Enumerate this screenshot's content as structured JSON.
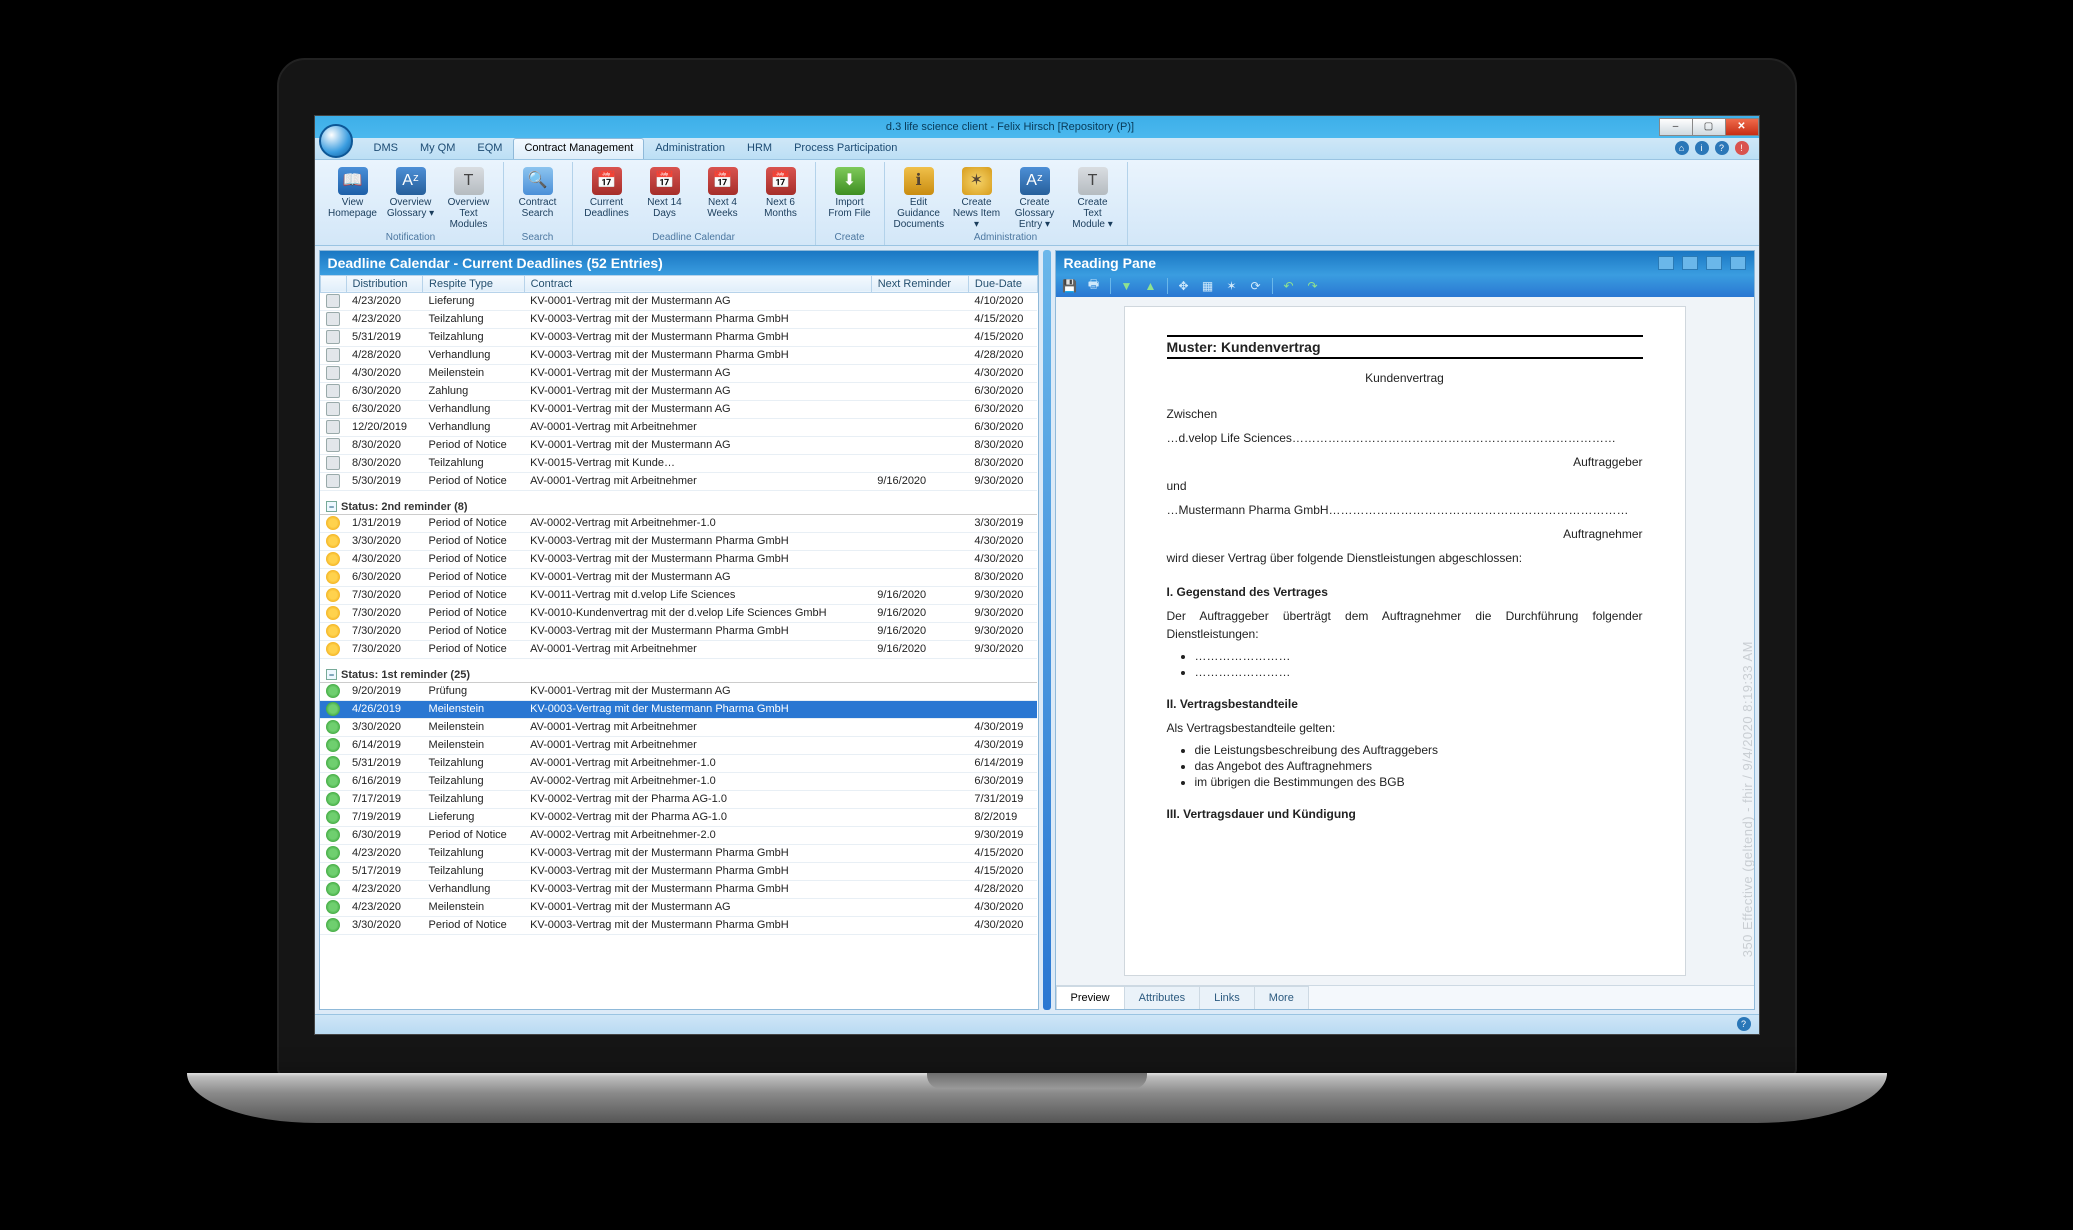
{
  "window": {
    "title": "d.3 life science client - Felix Hirsch [Repository (P)]",
    "min": "–",
    "max": "▢",
    "close": "✕"
  },
  "menus": {
    "items": [
      "DMS",
      "My QM",
      "EQM",
      "Contract Management",
      "Administration",
      "HRM",
      "Process Participation"
    ],
    "active_index": 3
  },
  "ribbon": {
    "groups": [
      {
        "label": "Notification",
        "buttons": [
          {
            "label": "View Homepage",
            "icon": "📖",
            "cls": "ci-blue"
          },
          {
            "label": "Overview Glossary ▾",
            "icon": "Aᶻ",
            "cls": "ci-teal"
          },
          {
            "label": "Overview Text Modules",
            "icon": "T",
            "cls": "ci-grey"
          }
        ]
      },
      {
        "label": "Search",
        "buttons": [
          {
            "label": "Contract Search",
            "icon": "🔍",
            "cls": "ci-search"
          }
        ]
      },
      {
        "label": "Deadline Calendar",
        "buttons": [
          {
            "label": "Current Deadlines",
            "icon": "📅",
            "cls": "ci-cal"
          },
          {
            "label": "Next 14 Days",
            "icon": "📅",
            "cls": "ci-cal"
          },
          {
            "label": "Next 4 Weeks",
            "icon": "📅",
            "cls": "ci-cal"
          },
          {
            "label": "Next 6 Months",
            "icon": "📅",
            "cls": "ci-cal"
          }
        ]
      },
      {
        "label": "Create",
        "buttons": [
          {
            "label": "Import From File",
            "icon": "⬇",
            "cls": "ci-green"
          }
        ]
      },
      {
        "label": "Administration",
        "buttons": [
          {
            "label": "Edit Guidance Documents",
            "icon": "ℹ",
            "cls": "ci-amber"
          },
          {
            "label": "Create News Item ▾",
            "icon": "✶",
            "cls": "ci-globe"
          },
          {
            "label": "Create Glossary Entry ▾",
            "icon": "Aᶻ",
            "cls": "ci-teal"
          },
          {
            "label": "Create Text Module ▾",
            "icon": "T",
            "cls": "ci-grey"
          }
        ]
      }
    ]
  },
  "left": {
    "title": "Deadline Calendar - Current Deadlines  (52 Entries)",
    "columns": [
      "",
      "Distribution",
      "Respite Type",
      "Contract",
      "Next Reminder",
      "Due-Date"
    ],
    "rows": [
      {
        "ic": "cal",
        "d": "4/23/2020",
        "r": "Lieferung",
        "c": "KV-0001-Vertrag mit der Mustermann AG",
        "nr": "",
        "dd": "4/10/2020"
      },
      {
        "ic": "cal",
        "d": "4/23/2020",
        "r": "Teilzahlung",
        "c": "KV-0003-Vertrag mit der Mustermann Pharma GmbH",
        "nr": "",
        "dd": "4/15/2020"
      },
      {
        "ic": "cal",
        "d": "5/31/2019",
        "r": "Teilzahlung",
        "c": "KV-0003-Vertrag mit der Mustermann Pharma GmbH",
        "nr": "",
        "dd": "4/15/2020"
      },
      {
        "ic": "cal",
        "d": "4/28/2020",
        "r": "Verhandlung",
        "c": "KV-0003-Vertrag mit der Mustermann Pharma GmbH",
        "nr": "",
        "dd": "4/28/2020"
      },
      {
        "ic": "cal",
        "d": "4/30/2020",
        "r": "Meilenstein",
        "c": "KV-0001-Vertrag mit der Mustermann AG",
        "nr": "",
        "dd": "4/30/2020"
      },
      {
        "ic": "cal",
        "d": "6/30/2020",
        "r": "Zahlung",
        "c": "KV-0001-Vertrag mit der Mustermann AG",
        "nr": "",
        "dd": "6/30/2020"
      },
      {
        "ic": "cal",
        "d": "6/30/2020",
        "r": "Verhandlung",
        "c": "KV-0001-Vertrag mit der Mustermann AG",
        "nr": "",
        "dd": "6/30/2020"
      },
      {
        "ic": "cal",
        "d": "12/20/2019",
        "r": "Verhandlung",
        "c": "AV-0001-Vertrag mit Arbeitnehmer",
        "nr": "",
        "dd": "6/30/2020"
      },
      {
        "ic": "cal",
        "d": "8/30/2020",
        "r": "Period of Notice",
        "c": "KV-0001-Vertrag mit der Mustermann AG",
        "nr": "",
        "dd": "8/30/2020"
      },
      {
        "ic": "cal",
        "d": "8/30/2020",
        "r": "Teilzahlung",
        "c": "KV-0015-Vertrag mit Kunde…",
        "nr": "",
        "dd": "8/30/2020"
      },
      {
        "ic": "cal",
        "d": "5/30/2019",
        "r": "Period of Notice",
        "c": "AV-0001-Vertrag mit Arbeitnehmer",
        "nr": "9/16/2020",
        "dd": "9/30/2020"
      }
    ],
    "group2": {
      "title": "Status: 2nd reminder (8)",
      "rows": [
        {
          "ic": "warn",
          "d": "1/31/2019",
          "r": "Period of Notice",
          "c": "AV-0002-Vertrag mit Arbeitnehmer-1.0",
          "nr": "",
          "dd": "3/30/2019"
        },
        {
          "ic": "warn",
          "d": "3/30/2020",
          "r": "Period of Notice",
          "c": "KV-0003-Vertrag mit der Mustermann Pharma GmbH",
          "nr": "",
          "dd": "4/30/2020"
        },
        {
          "ic": "warn",
          "d": "4/30/2020",
          "r": "Period of Notice",
          "c": "KV-0003-Vertrag mit der Mustermann Pharma GmbH",
          "nr": "",
          "dd": "4/30/2020"
        },
        {
          "ic": "warn",
          "d": "6/30/2020",
          "r": "Period of Notice",
          "c": "KV-0001-Vertrag mit der Mustermann AG",
          "nr": "",
          "dd": "8/30/2020"
        },
        {
          "ic": "warn",
          "d": "7/30/2020",
          "r": "Period of Notice",
          "c": "KV-0011-Vertrag mit d.velop Life Sciences",
          "nr": "9/16/2020",
          "dd": "9/30/2020"
        },
        {
          "ic": "warn",
          "d": "7/30/2020",
          "r": "Period of Notice",
          "c": "KV-0010-Kundenvertrag mit der d.velop Life Sciences GmbH",
          "nr": "9/16/2020",
          "dd": "9/30/2020"
        },
        {
          "ic": "warn",
          "d": "7/30/2020",
          "r": "Period of Notice",
          "c": "KV-0003-Vertrag mit der Mustermann Pharma GmbH",
          "nr": "9/16/2020",
          "dd": "9/30/2020"
        },
        {
          "ic": "warn",
          "d": "7/30/2020",
          "r": "Period of Notice",
          "c": "AV-0001-Vertrag mit Arbeitnehmer",
          "nr": "9/16/2020",
          "dd": "9/30/2020"
        }
      ]
    },
    "group3": {
      "title": "Status: 1st reminder (25)",
      "rows": [
        {
          "ic": "info",
          "d": "9/20/2019",
          "r": "Prüfung",
          "c": "KV-0001-Vertrag mit der Mustermann AG",
          "nr": "",
          "dd": ""
        },
        {
          "ic": "dl",
          "d": "4/26/2019",
          "r": "Meilenstein",
          "c": "KV-0003-Vertrag mit der Mustermann Pharma GmbH",
          "nr": "",
          "dd": "",
          "selected": true
        },
        {
          "ic": "info",
          "d": "3/30/2020",
          "r": "Meilenstein",
          "c": "AV-0001-Vertrag mit Arbeitnehmer",
          "nr": "",
          "dd": "4/30/2019"
        },
        {
          "ic": "info",
          "d": "6/14/2019",
          "r": "Meilenstein",
          "c": "AV-0001-Vertrag mit Arbeitnehmer",
          "nr": "",
          "dd": "4/30/2019"
        },
        {
          "ic": "info",
          "d": "5/31/2019",
          "r": "Teilzahlung",
          "c": "AV-0001-Vertrag mit Arbeitnehmer-1.0",
          "nr": "",
          "dd": "6/14/2019"
        },
        {
          "ic": "info",
          "d": "6/16/2019",
          "r": "Teilzahlung",
          "c": "AV-0002-Vertrag mit Arbeitnehmer-1.0",
          "nr": "",
          "dd": "6/30/2019"
        },
        {
          "ic": "info",
          "d": "7/17/2019",
          "r": "Teilzahlung",
          "c": "KV-0002-Vertrag mit der Pharma AG-1.0",
          "nr": "",
          "dd": "7/31/2019"
        },
        {
          "ic": "info",
          "d": "7/19/2019",
          "r": "Lieferung",
          "c": "KV-0002-Vertrag mit der Pharma AG-1.0",
          "nr": "",
          "dd": "8/2/2019"
        },
        {
          "ic": "info",
          "d": "6/30/2019",
          "r": "Period of Notice",
          "c": "AV-0002-Vertrag mit Arbeitnehmer-2.0",
          "nr": "",
          "dd": "9/30/2019"
        },
        {
          "ic": "info",
          "d": "4/23/2020",
          "r": "Teilzahlung",
          "c": "KV-0003-Vertrag mit der Mustermann Pharma GmbH",
          "nr": "",
          "dd": "4/15/2020"
        },
        {
          "ic": "info",
          "d": "5/17/2019",
          "r": "Teilzahlung",
          "c": "KV-0003-Vertrag mit der Mustermann Pharma GmbH",
          "nr": "",
          "dd": "4/15/2020"
        },
        {
          "ic": "info",
          "d": "4/23/2020",
          "r": "Verhandlung",
          "c": "KV-0003-Vertrag mit der Mustermann Pharma GmbH",
          "nr": "",
          "dd": "4/28/2020"
        },
        {
          "ic": "info",
          "d": "4/23/2020",
          "r": "Meilenstein",
          "c": "KV-0001-Vertrag mit der Mustermann AG",
          "nr": "",
          "dd": "4/30/2020"
        },
        {
          "ic": "info",
          "d": "3/30/2020",
          "r": "Period of Notice",
          "c": "KV-0003-Vertrag mit der Mustermann Pharma GmbH",
          "nr": "",
          "dd": "4/30/2020"
        }
      ]
    }
  },
  "right": {
    "title": "Reading Pane",
    "tabs": [
      "Preview",
      "Attributes",
      "Links",
      "More"
    ],
    "active_tab": 0,
    "watermark": "350 Effective (geltend) - fhir / 9/4/2020 8:19:33 AM",
    "doc": {
      "heading": "Muster: Kundenvertrag",
      "subtitle": "Kundenvertrag",
      "p1": "Zwischen",
      "party1": "…d.velop Life Sciences………………………………………………………………………",
      "role1": "Auftraggeber",
      "p2": "und",
      "party2": "…Mustermann Pharma GmbH…………………………………………………………………",
      "role2": "Auftragnehmer",
      "intro": "wird dieser Vertrag über folgende Dienstleistungen abgeschlossen:",
      "s1h": "I. Gegenstand des Vertrages",
      "s1p": "Der Auftraggeber überträgt dem Auftragnehmer die Durchführung folgender Dienstleistungen:",
      "s1b1": "……………………",
      "s1b2": "……………………",
      "s2h": "II. Vertragsbestandteile",
      "s2p": "Als Vertragsbestandteile gelten:",
      "s2b1": "die Leistungsbeschreibung des Auftraggebers",
      "s2b2": "das Angebot des Auftragnehmers",
      "s2b3": "im übrigen die Bestimmungen des BGB",
      "s3h": "III. Vertragsdauer und Kündigung"
    }
  }
}
